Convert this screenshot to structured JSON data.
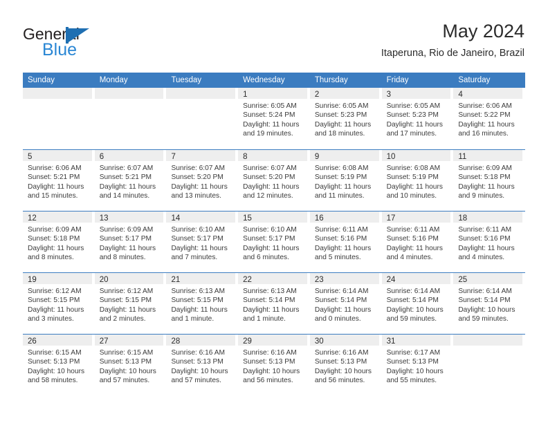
{
  "brand": {
    "name_top": "General",
    "name_bottom": "Blue",
    "mark": "triangle-flag-icon"
  },
  "header": {
    "title": "May 2024",
    "subtitle": "Itaperuna, Rio de Janeiro, Brazil"
  },
  "calendar": {
    "weekday_headers": [
      "Sunday",
      "Monday",
      "Tuesday",
      "Wednesday",
      "Thursday",
      "Friday",
      "Saturday"
    ],
    "accent_color": "#3b7cc0",
    "band_color": "#eeeeee",
    "weeks": [
      [
        {
          "day": "",
          "lines": []
        },
        {
          "day": "",
          "lines": []
        },
        {
          "day": "",
          "lines": []
        },
        {
          "day": "1",
          "lines": [
            "Sunrise: 6:05 AM",
            "Sunset: 5:24 PM",
            "Daylight: 11 hours",
            "and 19 minutes."
          ]
        },
        {
          "day": "2",
          "lines": [
            "Sunrise: 6:05 AM",
            "Sunset: 5:23 PM",
            "Daylight: 11 hours",
            "and 18 minutes."
          ]
        },
        {
          "day": "3",
          "lines": [
            "Sunrise: 6:05 AM",
            "Sunset: 5:23 PM",
            "Daylight: 11 hours",
            "and 17 minutes."
          ]
        },
        {
          "day": "4",
          "lines": [
            "Sunrise: 6:06 AM",
            "Sunset: 5:22 PM",
            "Daylight: 11 hours",
            "and 16 minutes."
          ]
        }
      ],
      [
        {
          "day": "5",
          "lines": [
            "Sunrise: 6:06 AM",
            "Sunset: 5:21 PM",
            "Daylight: 11 hours",
            "and 15 minutes."
          ]
        },
        {
          "day": "6",
          "lines": [
            "Sunrise: 6:07 AM",
            "Sunset: 5:21 PM",
            "Daylight: 11 hours",
            "and 14 minutes."
          ]
        },
        {
          "day": "7",
          "lines": [
            "Sunrise: 6:07 AM",
            "Sunset: 5:20 PM",
            "Daylight: 11 hours",
            "and 13 minutes."
          ]
        },
        {
          "day": "8",
          "lines": [
            "Sunrise: 6:07 AM",
            "Sunset: 5:20 PM",
            "Daylight: 11 hours",
            "and 12 minutes."
          ]
        },
        {
          "day": "9",
          "lines": [
            "Sunrise: 6:08 AM",
            "Sunset: 5:19 PM",
            "Daylight: 11 hours",
            "and 11 minutes."
          ]
        },
        {
          "day": "10",
          "lines": [
            "Sunrise: 6:08 AM",
            "Sunset: 5:19 PM",
            "Daylight: 11 hours",
            "and 10 minutes."
          ]
        },
        {
          "day": "11",
          "lines": [
            "Sunrise: 6:09 AM",
            "Sunset: 5:18 PM",
            "Daylight: 11 hours",
            "and 9 minutes."
          ]
        }
      ],
      [
        {
          "day": "12",
          "lines": [
            "Sunrise: 6:09 AM",
            "Sunset: 5:18 PM",
            "Daylight: 11 hours",
            "and 8 minutes."
          ]
        },
        {
          "day": "13",
          "lines": [
            "Sunrise: 6:09 AM",
            "Sunset: 5:17 PM",
            "Daylight: 11 hours",
            "and 8 minutes."
          ]
        },
        {
          "day": "14",
          "lines": [
            "Sunrise: 6:10 AM",
            "Sunset: 5:17 PM",
            "Daylight: 11 hours",
            "and 7 minutes."
          ]
        },
        {
          "day": "15",
          "lines": [
            "Sunrise: 6:10 AM",
            "Sunset: 5:17 PM",
            "Daylight: 11 hours",
            "and 6 minutes."
          ]
        },
        {
          "day": "16",
          "lines": [
            "Sunrise: 6:11 AM",
            "Sunset: 5:16 PM",
            "Daylight: 11 hours",
            "and 5 minutes."
          ]
        },
        {
          "day": "17",
          "lines": [
            "Sunrise: 6:11 AM",
            "Sunset: 5:16 PM",
            "Daylight: 11 hours",
            "and 4 minutes."
          ]
        },
        {
          "day": "18",
          "lines": [
            "Sunrise: 6:11 AM",
            "Sunset: 5:16 PM",
            "Daylight: 11 hours",
            "and 4 minutes."
          ]
        }
      ],
      [
        {
          "day": "19",
          "lines": [
            "Sunrise: 6:12 AM",
            "Sunset: 5:15 PM",
            "Daylight: 11 hours",
            "and 3 minutes."
          ]
        },
        {
          "day": "20",
          "lines": [
            "Sunrise: 6:12 AM",
            "Sunset: 5:15 PM",
            "Daylight: 11 hours",
            "and 2 minutes."
          ]
        },
        {
          "day": "21",
          "lines": [
            "Sunrise: 6:13 AM",
            "Sunset: 5:15 PM",
            "Daylight: 11 hours",
            "and 1 minute."
          ]
        },
        {
          "day": "22",
          "lines": [
            "Sunrise: 6:13 AM",
            "Sunset: 5:14 PM",
            "Daylight: 11 hours",
            "and 1 minute."
          ]
        },
        {
          "day": "23",
          "lines": [
            "Sunrise: 6:14 AM",
            "Sunset: 5:14 PM",
            "Daylight: 11 hours",
            "and 0 minutes."
          ]
        },
        {
          "day": "24",
          "lines": [
            "Sunrise: 6:14 AM",
            "Sunset: 5:14 PM",
            "Daylight: 10 hours",
            "and 59 minutes."
          ]
        },
        {
          "day": "25",
          "lines": [
            "Sunrise: 6:14 AM",
            "Sunset: 5:14 PM",
            "Daylight: 10 hours",
            "and 59 minutes."
          ]
        }
      ],
      [
        {
          "day": "26",
          "lines": [
            "Sunrise: 6:15 AM",
            "Sunset: 5:13 PM",
            "Daylight: 10 hours",
            "and 58 minutes."
          ]
        },
        {
          "day": "27",
          "lines": [
            "Sunrise: 6:15 AM",
            "Sunset: 5:13 PM",
            "Daylight: 10 hours",
            "and 57 minutes."
          ]
        },
        {
          "day": "28",
          "lines": [
            "Sunrise: 6:16 AM",
            "Sunset: 5:13 PM",
            "Daylight: 10 hours",
            "and 57 minutes."
          ]
        },
        {
          "day": "29",
          "lines": [
            "Sunrise: 6:16 AM",
            "Sunset: 5:13 PM",
            "Daylight: 10 hours",
            "and 56 minutes."
          ]
        },
        {
          "day": "30",
          "lines": [
            "Sunrise: 6:16 AM",
            "Sunset: 5:13 PM",
            "Daylight: 10 hours",
            "and 56 minutes."
          ]
        },
        {
          "day": "31",
          "lines": [
            "Sunrise: 6:17 AM",
            "Sunset: 5:13 PM",
            "Daylight: 10 hours",
            "and 55 minutes."
          ]
        },
        {
          "day": "",
          "lines": []
        }
      ]
    ]
  }
}
